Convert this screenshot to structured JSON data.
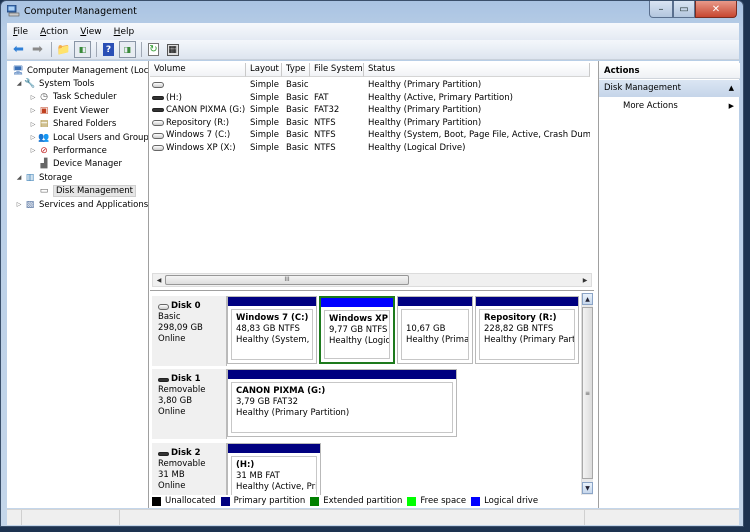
{
  "window": {
    "title": "Computer Management",
    "controls": {
      "minimize": "–",
      "maximize": "▭",
      "close": "✕"
    }
  },
  "menu": [
    {
      "label": "File",
      "mnemonic": "F",
      "rest": "ile"
    },
    {
      "label": "Action",
      "mnemonic": "A",
      "rest": "ction"
    },
    {
      "label": "View",
      "mnemonic": "V",
      "rest": "iew"
    },
    {
      "label": "Help",
      "mnemonic": "H",
      "rest": "elp"
    }
  ],
  "toolbar": {
    "back": "back-arrow-icon",
    "forward": "forward-arrow-icon",
    "up": "up-folder-icon",
    "show_hide_tree": "show-hide-console-tree-icon",
    "help": "help-icon",
    "show_hide_action": "show-hide-action-pane-icon",
    "refresh": "refresh-icon",
    "properties": "properties-icon"
  },
  "tree": [
    {
      "label": "Computer Management (Local",
      "level": 0,
      "expander": "",
      "icon": "computer-management-icon"
    },
    {
      "label": "System Tools",
      "level": 1,
      "expander": "expanded",
      "icon": "tools-icon"
    },
    {
      "label": "Task Scheduler",
      "level": 2,
      "expander": "collapsed",
      "icon": "clock-icon"
    },
    {
      "label": "Event Viewer",
      "level": 2,
      "expander": "collapsed",
      "icon": "event-viewer-icon"
    },
    {
      "label": "Shared Folders",
      "level": 2,
      "expander": "collapsed",
      "icon": "shared-folders-icon"
    },
    {
      "label": "Local Users and Groups",
      "level": 2,
      "expander": "collapsed",
      "icon": "users-icon"
    },
    {
      "label": "Performance",
      "level": 2,
      "expander": "collapsed",
      "icon": "performance-icon"
    },
    {
      "label": "Device Manager",
      "level": 2,
      "expander": "",
      "icon": "device-manager-icon"
    },
    {
      "label": "Storage",
      "level": 1,
      "expander": "expanded",
      "icon": "storage-icon"
    },
    {
      "label": "Disk Management",
      "level": 2,
      "expander": "",
      "icon": "disk-management-icon",
      "selected": true
    },
    {
      "label": "Services and Applications",
      "level": 1,
      "expander": "collapsed",
      "icon": "services-icon"
    }
  ],
  "volume_list": {
    "columns": [
      "Volume",
      "Layout",
      "Type",
      "File System",
      "Status"
    ],
    "rows": [
      {
        "volume": "",
        "icon": "light",
        "layout": "Simple",
        "type": "Basic",
        "fs": "",
        "status": "Healthy (Primary Partition)"
      },
      {
        "volume": " (H:)",
        "icon": "dark",
        "layout": "Simple",
        "type": "Basic",
        "fs": "FAT",
        "status": "Healthy (Active, Primary Partition)"
      },
      {
        "volume": "CANON PIXMA (G:)",
        "icon": "dark",
        "layout": "Simple",
        "type": "Basic",
        "fs": "FAT32",
        "status": "Healthy (Primary Partition)"
      },
      {
        "volume": "Repository (R:)",
        "icon": "light",
        "layout": "Simple",
        "type": "Basic",
        "fs": "NTFS",
        "status": "Healthy (Primary Partition)"
      },
      {
        "volume": "Windows 7 (C:)",
        "icon": "light",
        "layout": "Simple",
        "type": "Basic",
        "fs": "NTFS",
        "status": "Healthy (System, Boot, Page File, Active, Crash Dump, Pri"
      },
      {
        "volume": "Windows XP (X:)",
        "icon": "light",
        "layout": "Simple",
        "type": "Basic",
        "fs": "NTFS",
        "status": "Healthy (Logical Drive)"
      }
    ],
    "scroll_grip": "III"
  },
  "disks": [
    {
      "name": "Disk 0",
      "kind": "Basic",
      "size": "298,09 GB",
      "state": "Online",
      "icon": "light",
      "partitions": [
        {
          "name": "Windows 7  (C:)",
          "size": "48,83 GB NTFS",
          "status": "Healthy (System, Bo",
          "color": "#000080",
          "selected": false
        },
        {
          "name": "Windows XP  (",
          "size": "9,77 GB NTFS",
          "status": "Healthy (Logica",
          "color": "#0000ff",
          "selected": true
        },
        {
          "name": "",
          "size": "10,67 GB",
          "status": "Healthy (Primary",
          "color": "#000080",
          "selected": false
        },
        {
          "name": "Repository  (R:)",
          "size": "228,82 GB NTFS",
          "status": "Healthy (Primary Partiti",
          "color": "#000080",
          "selected": false
        }
      ]
    },
    {
      "name": "Disk 1",
      "kind": "Removable",
      "size": "3,80 GB",
      "state": "Online",
      "icon": "dark",
      "partitions": [
        {
          "name": "CANON PIXMA  (G:)",
          "size": "3,79 GB FAT32",
          "status": "Healthy (Primary Partition)",
          "color": "#000080",
          "selected": false
        }
      ]
    },
    {
      "name": "Disk 2",
      "kind": "Removable",
      "size": "31 MB",
      "state": "Online",
      "icon": "dark",
      "partitions": [
        {
          "name": " (H:)",
          "size": "31 MB FAT",
          "status": "Healthy (Active, Prim",
          "color": "#000080",
          "selected": false
        }
      ]
    }
  ],
  "legend": [
    {
      "label": "Unallocated",
      "color": "#000000"
    },
    {
      "label": "Primary partition",
      "color": "#000080"
    },
    {
      "label": "Extended partition",
      "color": "#008000"
    },
    {
      "label": "Free space",
      "color": "#00ff00"
    },
    {
      "label": "Logical drive",
      "color": "#0000ff"
    }
  ],
  "actions": {
    "title": "Actions",
    "section": "Disk Management",
    "items": [
      "More Actions"
    ]
  }
}
